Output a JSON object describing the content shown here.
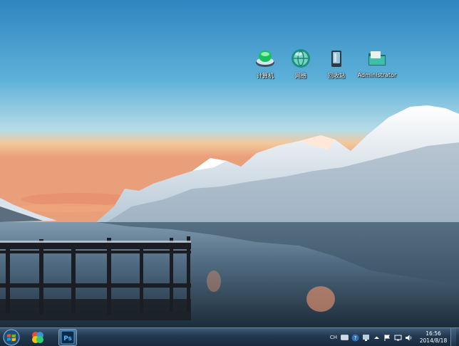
{
  "desktop": {
    "icons": [
      {
        "label": "计算机",
        "icon": "computer-icon"
      },
      {
        "label": "网络",
        "icon": "network-icon"
      },
      {
        "label": "回收站",
        "icon": "recycle-bin-icon"
      },
      {
        "label": "Administrator",
        "icon": "user-folder-icon"
      }
    ]
  },
  "taskbar": {
    "apps": [
      {
        "name": "start",
        "icon": "windows-logo-icon"
      },
      {
        "name": "colorful-app",
        "icon": "pinwheel-icon"
      },
      {
        "name": "photoshop",
        "icon": "photoshop-icon",
        "label": "Ps"
      }
    ],
    "tray": {
      "input_method": "CH",
      "icons": [
        "keyboard-icon",
        "help-icon",
        "network-tray-icon",
        "expand-tray-icon",
        "flag-icon",
        "display-icon",
        "volume-icon"
      ]
    },
    "clock": {
      "time": "16:56",
      "date": "2014/8/18"
    }
  },
  "colors": {
    "taskbar": "#22384f",
    "sky_top": "#3a8ec4",
    "sky_horizon": "#f3b985"
  }
}
